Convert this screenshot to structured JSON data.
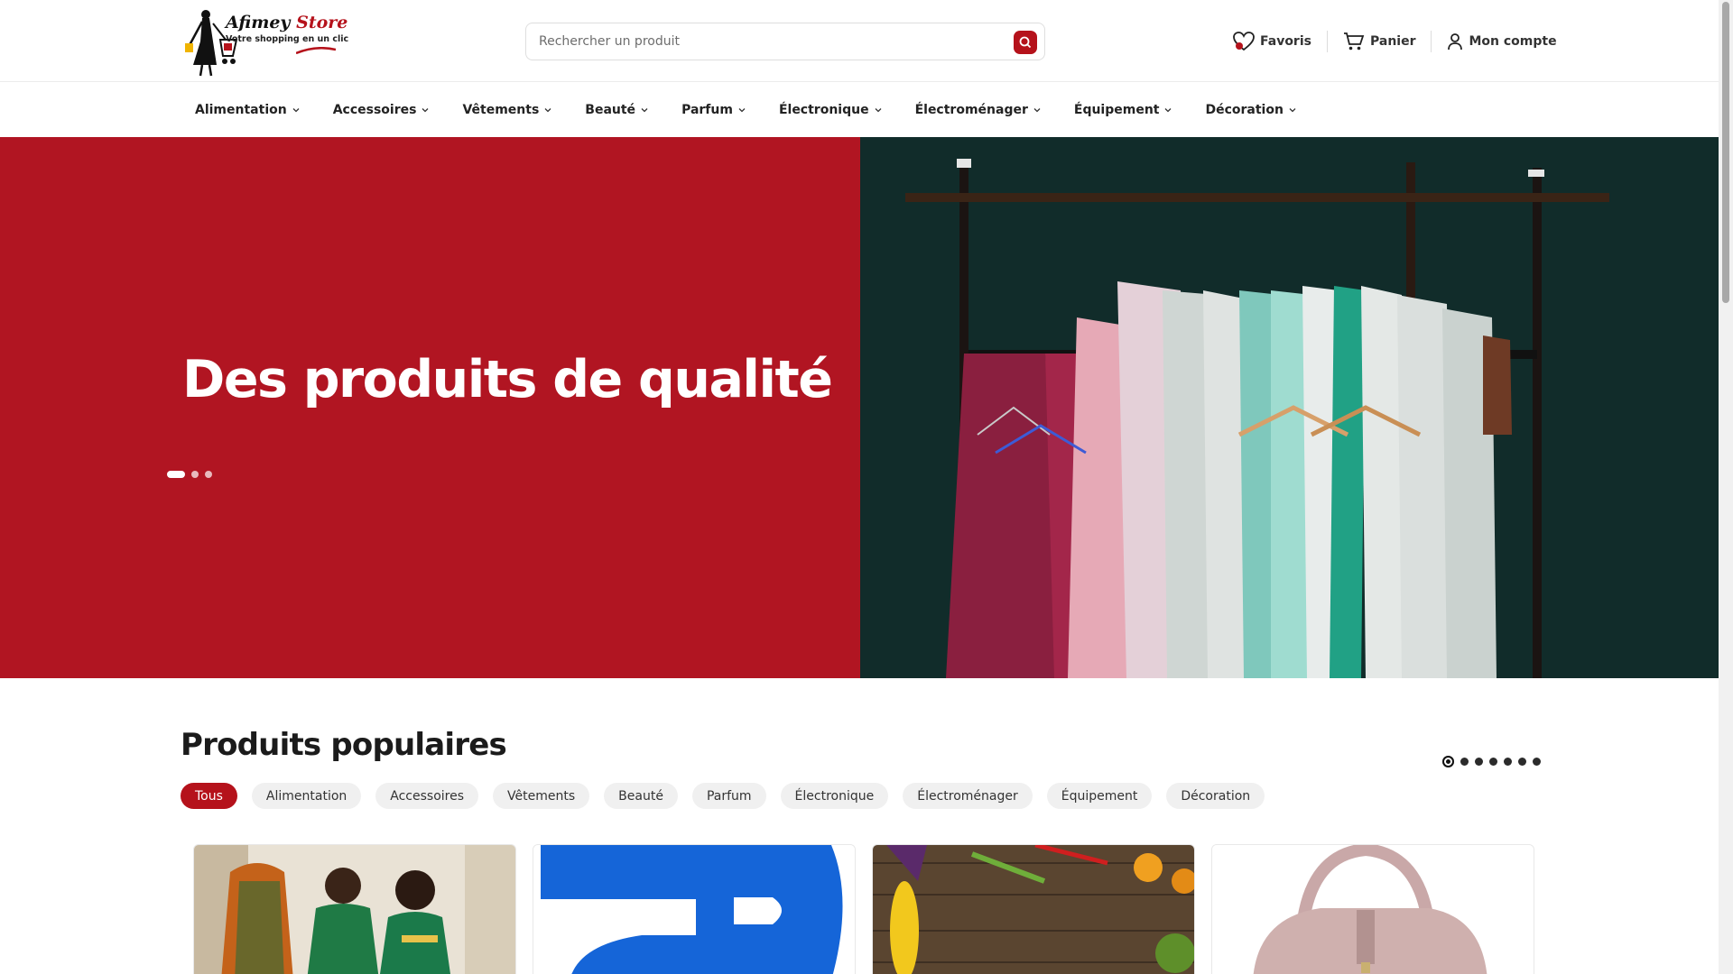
{
  "brand": {
    "name_part1": "Afimey",
    "name_part2": "Store",
    "tagline": "Votre shopping en un clic",
    "accent_color": "#b5121b"
  },
  "search": {
    "placeholder": "Rechercher un produit",
    "icon": "search-icon"
  },
  "header_links": [
    {
      "label": "Favoris",
      "icon": "heart-icon"
    },
    {
      "label": "Panier",
      "icon": "cart-icon"
    },
    {
      "label": "Mon compte",
      "icon": "user-icon"
    }
  ],
  "nav": {
    "items": [
      "Alimentation",
      "Accessoires",
      "Vêtements",
      "Beauté",
      "Parfum",
      "Électronique",
      "Électroménager",
      "Équipement",
      "Décoration"
    ]
  },
  "hero": {
    "title": "Des produits de qualité",
    "background_color": "#b11522",
    "slide_count": 3,
    "active_slide": 1,
    "image": "clothes-rack-photo"
  },
  "popular": {
    "title": "Produits populaires",
    "page_count": 7,
    "active_page": 1,
    "filters": [
      "Tous",
      "Alimentation",
      "Accessoires",
      "Vêtements",
      "Beauté",
      "Parfum",
      "Électronique",
      "Électroménager",
      "Équipement",
      "Décoration"
    ],
    "active_filter": "Tous",
    "cards": [
      {
        "image": "tailors-fabric-photo"
      },
      {
        "image": "blue-logo-image"
      },
      {
        "image": "vegetables-photo"
      },
      {
        "image": "pink-handbag-photo"
      }
    ]
  }
}
